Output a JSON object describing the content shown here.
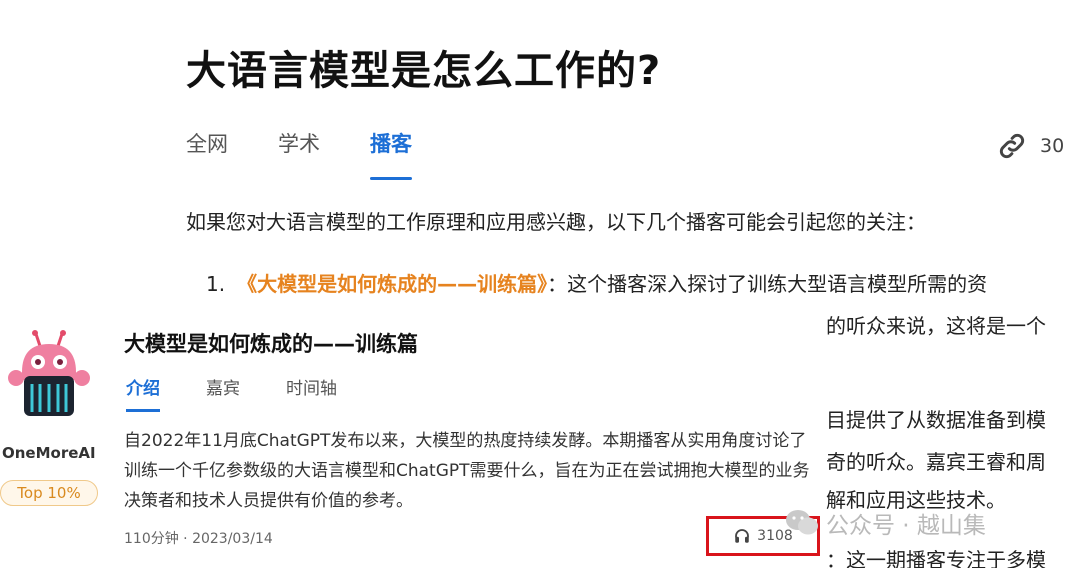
{
  "page": {
    "title": "大语言模型是怎么工作的?",
    "tabs": [
      "全网",
      "学术",
      "播客"
    ],
    "active_tab": "播客",
    "share_count": "30",
    "intro": "如果您对大语言模型的工作原理和应用感兴趣，以下几个播客可能会引起您的关注：",
    "list": {
      "number": "1.",
      "link": "《大模型是如何炼成的——训练篇》",
      "rest": "：这个播客深入探讨了训练大型语言模型所需的资"
    },
    "partial_lines": [
      "的听众来说，这将是一个",
      "目提供了从数据准备到模",
      "奇的听众。嘉宾王睿和周",
      "解和应用这些技术。",
      "：这一期播客专注于多模"
    ]
  },
  "card": {
    "author": "OneMoreAI",
    "badge": "Top 10%",
    "title": "大模型是如何炼成的——训练篇",
    "tabs": [
      "介绍",
      "嘉宾",
      "时间轴"
    ],
    "active_tab": "介绍",
    "description": "自2022年11月底ChatGPT发布以来，大模型的热度持续发酵。本期播客从实用角度讨论了训练一个千亿参数级的大语言模型和ChatGPT需要什么，旨在为正在尝试拥抱大模型的业务决策者和技术人员提供有价值的参考。",
    "meta": "110分钟 · 2023/03/14",
    "plays": "3108",
    "highlight_color": "#d9141b"
  },
  "watermark": "公众号 · 越山集",
  "colors": {
    "accent": "#1d6fd6",
    "link": "#e6831f",
    "badge": "#d98a1f"
  }
}
